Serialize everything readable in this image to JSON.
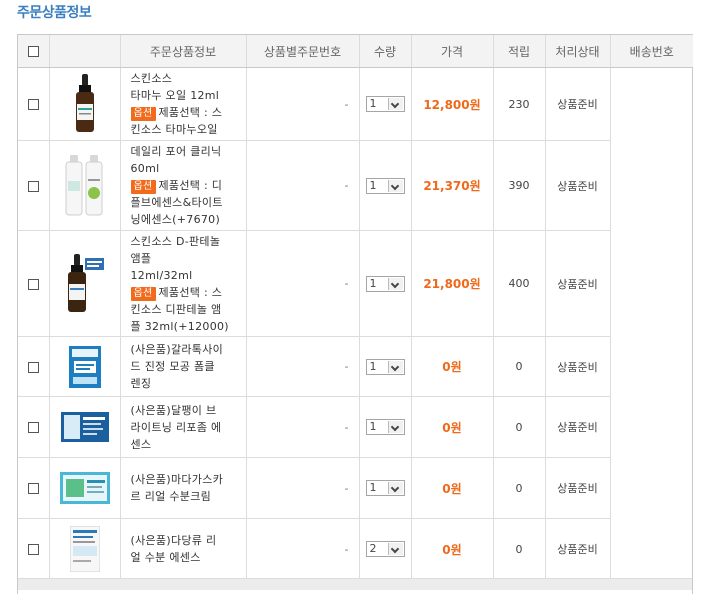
{
  "page": {
    "title": "주문상품정보"
  },
  "table": {
    "headers": [
      "주문상품정보",
      "상품별주문번호",
      "수량",
      "가격",
      "적립",
      "처리상태",
      "배송번호"
    ],
    "rows": [
      {
        "name": "스킨소스 타마누 오일 12ml",
        "name_lines": [
          "스킨소스",
          "타마누 오일 12ml"
        ],
        "option_badge": "옵션",
        "option_lines": [
          "제품선택 : 스",
          "킨소스 타마누오일"
        ],
        "order_no": "-",
        "qty": "1",
        "price": "12,800원",
        "points": "230",
        "status": "상품준비",
        "thumb": "dropper-bottle-icon"
      },
      {
        "name": "데일리 포어 클리닉 60ml",
        "name_lines": [
          "데일리 포어 클리닉",
          "60ml"
        ],
        "option_badge": "옵션",
        "option_lines": [
          "제품선택 : 디",
          "플브에센스&타이트",
          "닝에센스(+7670)"
        ],
        "order_no": "-",
        "qty": "1",
        "price": "21,370원",
        "points": "390",
        "status": "상품준비",
        "thumb": "serum-bottles-icon"
      },
      {
        "name": "스킨소스 D-판테놀 앰플 12ml/32ml",
        "name_lines": [
          "스킨소스 D-판테놀",
          "앰플",
          "12ml/32ml"
        ],
        "option_badge": "옵션",
        "option_lines": [
          "제품선택 : 스",
          "킨소스 디판테놀 앰",
          "플 32ml(+12000)"
        ],
        "order_no": "-",
        "qty": "1",
        "price": "21,800원",
        "points": "400",
        "status": "상품준비",
        "thumb": "ampoule-bottle-icon"
      },
      {
        "name": "(사은품)갈라톡사이드 진정 모공 폼클렌징",
        "name_lines": [
          "(사은품)갈라톡사이",
          "드 진정 모공 폼클",
          "렌징"
        ],
        "option_badge": "",
        "option_lines": [],
        "order_no": "-",
        "qty": "1",
        "price": "0원",
        "points": "0",
        "status": "상품준비",
        "thumb": "sample-pouch-icon"
      },
      {
        "name": "(사은품)달팽이 브라이트닝 리포좀 에센스",
        "name_lines": [
          "(사은품)달팽이 브",
          "라이트닝 리포좀 에",
          "센스"
        ],
        "option_badge": "",
        "option_lines": [],
        "order_no": "-",
        "qty": "1",
        "price": "0원",
        "points": "0",
        "status": "상품준비",
        "thumb": "sample-pouch-icon"
      },
      {
        "name": "(사은품)마다가스카르 리얼 수분크림",
        "name_lines": [
          "(사은품)마다가스카",
          "르 리얼 수분크림"
        ],
        "option_badge": "",
        "option_lines": [],
        "order_no": "-",
        "qty": "1",
        "price": "0원",
        "points": "0",
        "status": "상품준비",
        "thumb": "sample-pouch-icon"
      },
      {
        "name": "(사은품)다당류 리얼 수분 에센스",
        "name_lines": [
          "(사은품)다당류 리",
          "얼 수분 에센스"
        ],
        "option_badge": "",
        "option_lines": [],
        "order_no": "-",
        "qty": "2",
        "price": "0원",
        "points": "0",
        "status": "상품준비",
        "thumb": "sample-pouch-icon"
      }
    ]
  },
  "colors": {
    "accent": "#3a7fc1",
    "price": "#ee6a1a",
    "option_badge": "#f26b1d"
  }
}
